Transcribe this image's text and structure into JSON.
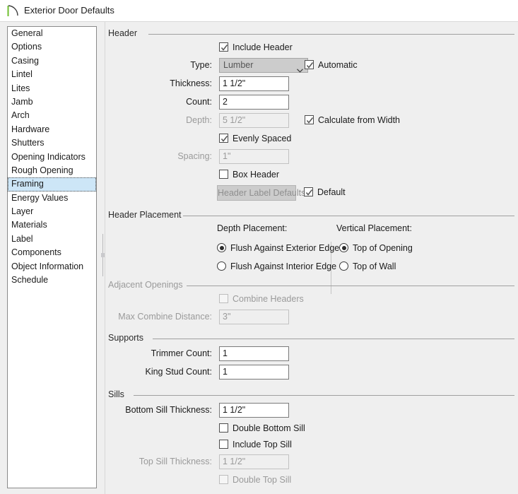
{
  "window": {
    "title": "Exterior Door Defaults",
    "icon": "door-swing-icon",
    "icon_color": "#6fbf2f"
  },
  "sidebar": {
    "items": [
      {
        "label": "General",
        "selected": false
      },
      {
        "label": "Options",
        "selected": false
      },
      {
        "label": "Casing",
        "selected": false
      },
      {
        "label": "Lintel",
        "selected": false
      },
      {
        "label": "Lites",
        "selected": false
      },
      {
        "label": "Jamb",
        "selected": false
      },
      {
        "label": "Arch",
        "selected": false
      },
      {
        "label": "Hardware",
        "selected": false
      },
      {
        "label": "Shutters",
        "selected": false
      },
      {
        "label": "Opening Indicators",
        "selected": false
      },
      {
        "label": "Rough Opening",
        "selected": false
      },
      {
        "label": "Framing",
        "selected": true
      },
      {
        "label": "Energy Values",
        "selected": false
      },
      {
        "label": "Layer",
        "selected": false
      },
      {
        "label": "Materials",
        "selected": false
      },
      {
        "label": "Label",
        "selected": false
      },
      {
        "label": "Components",
        "selected": false
      },
      {
        "label": "Object Information",
        "selected": false
      },
      {
        "label": "Schedule",
        "selected": false
      }
    ]
  },
  "groups": {
    "header": "Header",
    "header_placement": "Header Placement",
    "adjacent_openings": "Adjacent Openings",
    "supports": "Supports",
    "sills": "Sills"
  },
  "header": {
    "include_header_label": "Include Header",
    "include_header_checked": true,
    "type_label": "Type:",
    "type_value": "Lumber",
    "automatic_label": "Automatic",
    "automatic_checked": true,
    "thickness_label": "Thickness:",
    "thickness_value": "1 1/2\"",
    "count_label": "Count:",
    "count_value": "2",
    "depth_label": "Depth:",
    "depth_value": "5 1/2\"",
    "calculate_from_width_label": "Calculate from Width",
    "calculate_from_width_checked": true,
    "evenly_spaced_label": "Evenly Spaced",
    "evenly_spaced_checked": true,
    "spacing_label": "Spacing:",
    "spacing_value": "1\"",
    "box_header_label": "Box Header",
    "box_header_checked": false,
    "header_label_defaults_button": "Header Label Defaults",
    "default_label": "Default",
    "default_checked": true
  },
  "header_placement": {
    "depth_placement_caption": "Depth Placement:",
    "vertical_placement_caption": "Vertical Placement:",
    "depth_options": [
      {
        "label": "Flush Against Exterior Edge",
        "selected": true
      },
      {
        "label": "Flush Against Interior Edge",
        "selected": false
      }
    ],
    "vertical_options": [
      {
        "label": "Top of Opening",
        "selected": true
      },
      {
        "label": "Top of Wall",
        "selected": false
      }
    ]
  },
  "adjacent_openings": {
    "combine_headers_label": "Combine Headers",
    "combine_headers_checked": false,
    "max_combine_distance_label": "Max Combine Distance:",
    "max_combine_distance_value": "3\""
  },
  "supports": {
    "trimmer_count_label": "Trimmer Count:",
    "trimmer_count_value": "1",
    "king_stud_count_label": "King Stud Count:",
    "king_stud_count_value": "1"
  },
  "sills": {
    "bottom_sill_thickness_label": "Bottom Sill Thickness:",
    "bottom_sill_thickness_value": "1 1/2\"",
    "double_bottom_sill_label": "Double Bottom Sill",
    "double_bottom_sill_checked": false,
    "include_top_sill_label": "Include Top Sill",
    "include_top_sill_checked": false,
    "top_sill_thickness_label": "Top Sill Thickness:",
    "top_sill_thickness_value": "1 1/2\"",
    "double_top_sill_label": "Double Top Sill",
    "double_top_sill_checked": false
  }
}
